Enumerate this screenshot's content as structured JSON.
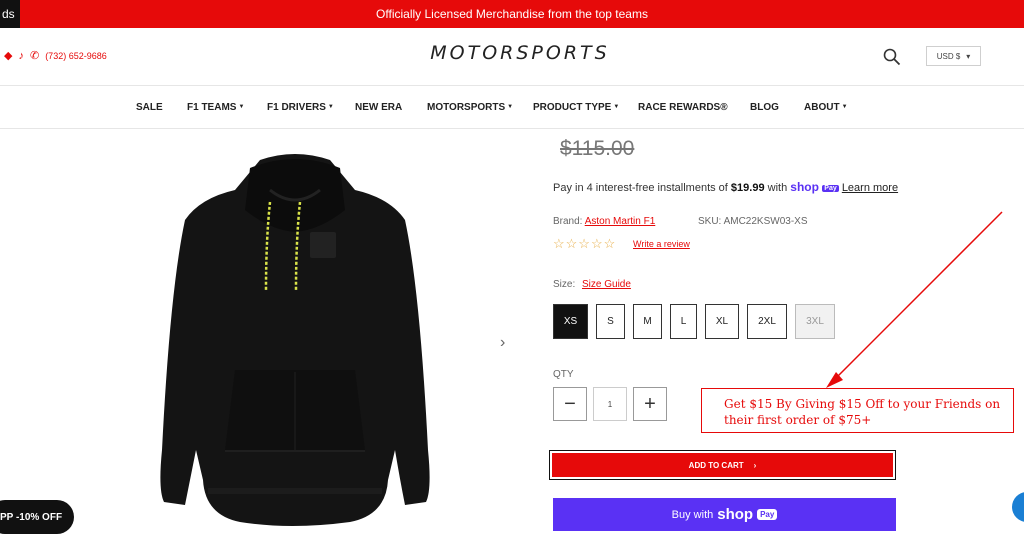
{
  "announcement": {
    "tab_stub": "ds",
    "text": "Officially Licensed Merchandise from the top teams"
  },
  "header": {
    "phone": "(732) 652-9686",
    "logo": "MOTORSPORTS",
    "currency": "USD $"
  },
  "nav": {
    "items": [
      {
        "label": "SALE",
        "dropdown": false
      },
      {
        "label": "F1 TEAMS",
        "dropdown": true
      },
      {
        "label": "F1 DRIVERS",
        "dropdown": true
      },
      {
        "label": "NEW ERA",
        "dropdown": false
      },
      {
        "label": "MOTORSPORTS",
        "dropdown": true
      },
      {
        "label": "PRODUCT TYPE",
        "dropdown": true
      },
      {
        "label": "RACE REWARDS®",
        "dropdown": false
      },
      {
        "label": "BLOG",
        "dropdown": false
      },
      {
        "label": "ABOUT",
        "dropdown": true
      }
    ]
  },
  "product": {
    "price": "$115.00",
    "installments_prefix": "Pay in 4 interest-free installments of",
    "installment_amount": "$19.99",
    "installments_with": "with",
    "shop_text": "shop",
    "pay_text": "Pay",
    "learn_more": "Learn more",
    "brand_label": "Brand:",
    "brand": "Aston Martin F1",
    "sku_label": "SKU:",
    "sku": "AMC22KSW03-XS",
    "rating_stars": "☆☆☆☆☆",
    "write_review": "Write a review",
    "size_label": "Size:",
    "size_guide": "Size Guide",
    "sizes": [
      {
        "label": "XS",
        "state": "selected"
      },
      {
        "label": "S",
        "state": "available"
      },
      {
        "label": "M",
        "state": "available"
      },
      {
        "label": "L",
        "state": "available"
      },
      {
        "label": "XL",
        "state": "available"
      },
      {
        "label": "2XL",
        "state": "available"
      },
      {
        "label": "3XL",
        "state": "disabled"
      }
    ],
    "qty_label": "QTY",
    "qty_value": "1",
    "add_to_cart": "ADD TO CART",
    "buy_with": "Buy with",
    "buy_shop": "shop",
    "buy_pay": "Pay"
  },
  "promo": {
    "line1": "Get $15 By Giving $15 Off to your Friends on",
    "line2": "their first order of $75+"
  },
  "discount_pill": "PP -10% OFF",
  "colors": {
    "brand_red": "#e60a0a",
    "shop_purple": "#5a31f4",
    "annotation_red": "#e60a0a"
  }
}
